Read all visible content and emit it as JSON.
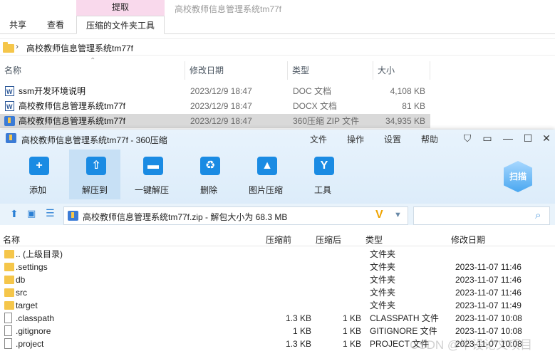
{
  "explorer": {
    "context_tab_header": "提取",
    "window_title": "高校教师信息管理系统tm77f",
    "tabs": [
      "共享",
      "查看",
      "压缩的文件夹工具"
    ],
    "address_path": "高校教师信息管理系统tm77f",
    "columns": [
      "名称",
      "修改日期",
      "类型",
      "大小"
    ],
    "files": [
      {
        "name": "ssm开发环境说明",
        "date": "2023/12/9 18:47",
        "type": "DOC 文档",
        "size": "4,108 KB",
        "icon": "word-doc-icon"
      },
      {
        "name": "高校教师信息管理系统tm77f",
        "date": "2023/12/9 18:47",
        "type": "DOCX 文档",
        "size": "81 KB",
        "icon": "word-doc-icon"
      },
      {
        "name": "高校教师信息管理系统tm77f",
        "date": "2023/12/9 18:47",
        "type": "360压缩 ZIP 文件",
        "size": "34,935 KB",
        "icon": "zip-archive-icon"
      }
    ]
  },
  "zipwin": {
    "title": "高校教师信息管理系统tm77f - 360压缩",
    "menu": [
      "文件",
      "操作",
      "设置",
      "帮助"
    ],
    "toolbar": [
      {
        "label": "添加",
        "icon": "add-icon",
        "glyph": "+"
      },
      {
        "label": "解压到",
        "icon": "extract-icon",
        "glyph": "⇧"
      },
      {
        "label": "一键解压",
        "icon": "one-click-extract-icon",
        "glyph": "▬"
      },
      {
        "label": "删除",
        "icon": "trash-icon",
        "glyph": "♻"
      },
      {
        "label": "图片压缩",
        "icon": "image-compress-icon",
        "glyph": "▲"
      },
      {
        "label": "工具",
        "icon": "tools-icon",
        "glyph": "Y"
      }
    ],
    "scan_label": "扫描",
    "path_text": "高校教师信息管理系统tm77f.zip - 解包大小为 68.3 MB",
    "columns": [
      "名称",
      "压缩前",
      "压缩后",
      "类型",
      "修改日期"
    ],
    "rows": [
      {
        "name": ".. (上级目录)",
        "before": "",
        "after": "",
        "type": "文件夹",
        "date": "",
        "kind": "folder"
      },
      {
        "name": ".settings",
        "before": "",
        "after": "",
        "type": "文件夹",
        "date": "2023-11-07 11:46",
        "kind": "folder"
      },
      {
        "name": "db",
        "before": "",
        "after": "",
        "type": "文件夹",
        "date": "2023-11-07 11:46",
        "kind": "folder"
      },
      {
        "name": "src",
        "before": "",
        "after": "",
        "type": "文件夹",
        "date": "2023-11-07 11:46",
        "kind": "folder"
      },
      {
        "name": "target",
        "before": "",
        "after": "",
        "type": "文件夹",
        "date": "2023-11-07 11:49",
        "kind": "folder"
      },
      {
        "name": ".classpath",
        "before": "1.3 KB",
        "after": "1 KB",
        "type": "CLASSPATH 文件",
        "date": "2023-11-07 10:08",
        "kind": "file"
      },
      {
        "name": ".gitignore",
        "before": "1 KB",
        "after": "1 KB",
        "type": "GITIGNORE 文件",
        "date": "2023-11-07 10:08",
        "kind": "file"
      },
      {
        "name": ".project",
        "before": "1.3 KB",
        "after": "1 KB",
        "type": "PROJECT 文件",
        "date": "2023-11-07 10:08",
        "kind": "file"
      }
    ]
  },
  "watermark": "CSDN @毕设论文项目",
  "colors": {
    "accent": "#1a8be3",
    "selection": "#d9d9d9",
    "context_tab": "#f9d9ec",
    "folder": "#f5c64a"
  }
}
